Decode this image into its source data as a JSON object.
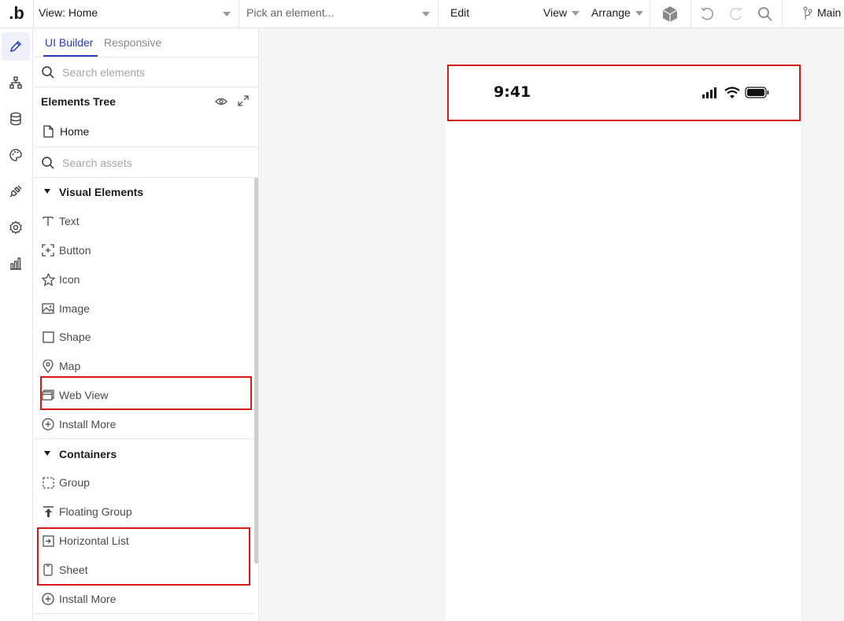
{
  "topbar": {
    "logo": ".b",
    "view_selector": "View: Home",
    "element_picker_placeholder": "Pick an element...",
    "menu_edit": "Edit",
    "menu_view": "View",
    "menu_arrange": "Arrange",
    "branch_label": "Main"
  },
  "panel": {
    "tabs": [
      "UI Builder",
      "Responsive"
    ],
    "search_elements_placeholder": "Search elements",
    "elements_tree_title": "Elements Tree",
    "tree_root": "Home",
    "search_assets_placeholder": "Search assets",
    "sections": [
      {
        "title": "Visual Elements",
        "items": [
          {
            "label": "Text",
            "icon": "text-icon"
          },
          {
            "label": "Button",
            "icon": "button-icon"
          },
          {
            "label": "Icon",
            "icon": "star-icon"
          },
          {
            "label": "Image",
            "icon": "image-icon"
          },
          {
            "label": "Shape",
            "icon": "square-icon"
          },
          {
            "label": "Map",
            "icon": "map-pin-icon"
          },
          {
            "label": "Web View",
            "icon": "web-view-icon"
          },
          {
            "label": "Install More",
            "icon": "plus-circle-icon"
          }
        ]
      },
      {
        "title": "Containers",
        "items": [
          {
            "label": "Group",
            "icon": "dashed-square-icon"
          },
          {
            "label": "Floating Group",
            "icon": "pin-top-icon"
          },
          {
            "label": "Horizontal List",
            "icon": "horizontal-list-icon"
          },
          {
            "label": "Sheet",
            "icon": "sheet-icon"
          },
          {
            "label": "Install More",
            "icon": "plus-circle-icon"
          }
        ]
      }
    ]
  },
  "canvas": {
    "status_time": "9:41"
  },
  "colors": {
    "accent": "#2a3bb7",
    "highlight": "#d11a1a",
    "canvas_bg": "#f5f5f5"
  }
}
